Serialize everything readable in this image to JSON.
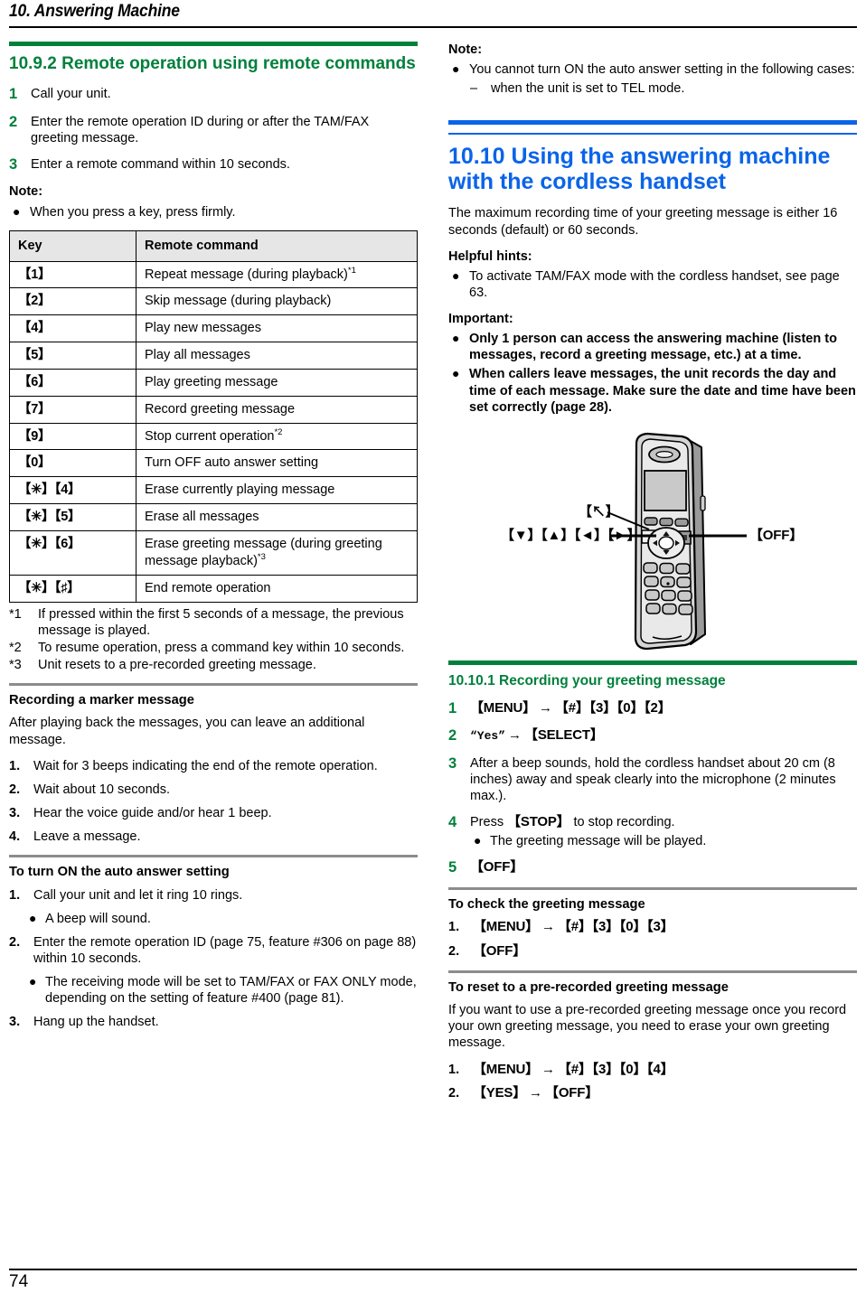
{
  "header": {
    "chapter_title": "10. Answering Machine"
  },
  "footer": {
    "page_number": "74"
  },
  "colors": {
    "green": "#00803C",
    "blue": "#0A64E8",
    "table_header_bg": "#E6E6E6",
    "rule_grey": "#8C8C8C"
  },
  "left": {
    "section": {
      "number_title": "10.9.2 Remote operation using remote commands"
    },
    "steps": [
      {
        "num": "1",
        "text": "Call your unit."
      },
      {
        "num": "2",
        "text": "Enter the remote operation ID during or after the TAM/FAX greeting message."
      },
      {
        "num": "3",
        "text": "Enter a remote command within 10 seconds."
      }
    ],
    "note_label": "Note:",
    "note_items": [
      "When you press a key, press firmly."
    ],
    "table": {
      "headers": [
        "Key",
        "Remote command"
      ],
      "rows": [
        {
          "key": "【1】",
          "command": "Repeat message (during playback)",
          "footnote": "*1"
        },
        {
          "key": "【2】",
          "command": "Skip message (during playback)",
          "footnote": ""
        },
        {
          "key": "【4】",
          "command": "Play new messages",
          "footnote": ""
        },
        {
          "key": "【5】",
          "command": "Play all messages",
          "footnote": ""
        },
        {
          "key": "【6】",
          "command": "Play greeting message",
          "footnote": ""
        },
        {
          "key": "【7】",
          "command": "Record greeting message",
          "footnote": ""
        },
        {
          "key": "【9】",
          "command": "Stop current operation",
          "footnote": "*2"
        },
        {
          "key": "【0】",
          "command": "Turn OFF auto answer setting",
          "footnote": ""
        },
        {
          "key": "【✳】【4】",
          "command": "Erase currently playing message",
          "footnote": ""
        },
        {
          "key": "【✳】【5】",
          "command": "Erase all messages",
          "footnote": ""
        },
        {
          "key": "【✳】【6】",
          "command": "Erase greeting message (during greeting message playback)",
          "footnote": "*3"
        },
        {
          "key": "【✳】【♯】",
          "command": "End remote operation",
          "footnote": ""
        }
      ]
    },
    "footnotes": [
      {
        "mark": "*1",
        "text": "If pressed within the first 5 seconds of a message, the previous message is played."
      },
      {
        "mark": "*2",
        "text": "To resume operation, press a command key within 10 seconds."
      },
      {
        "mark": "*3",
        "text": "Unit resets to a pre-recorded greeting message."
      }
    ],
    "marker_section": {
      "title": "Recording a marker message",
      "intro": "After playing back the messages, you can leave an additional message.",
      "steps": [
        {
          "num": "1.",
          "text": "Wait for 3 beeps indicating the end of the remote operation."
        },
        {
          "num": "2.",
          "text": "Wait about 10 seconds."
        },
        {
          "num": "3.",
          "text": "Hear the voice guide and/or hear 1 beep."
        },
        {
          "num": "4.",
          "text": "Leave a message."
        }
      ]
    },
    "auto_answer_section": {
      "title": "To turn ON the auto answer setting",
      "steps": [
        {
          "num": "1.",
          "text": "Call your unit and let it ring 10 rings.",
          "bullets": [
            "A beep will sound."
          ]
        },
        {
          "num": "2.",
          "text": "Enter the remote operation ID (page 75, feature #306 on page 88) within 10 seconds.",
          "bullets": [
            "The receiving mode will be set to TAM/FAX or FAX ONLY mode, depending on the setting of feature #400 (page 81)."
          ]
        },
        {
          "num": "3.",
          "text": "Hang up the handset.",
          "bullets": []
        }
      ]
    }
  },
  "right": {
    "note_label": "Note:",
    "note_items": [
      "You cannot turn ON the auto answer setting in the following cases:"
    ],
    "note_subitems": [
      {
        "dash": "–",
        "text": "when the unit is set to TEL mode."
      }
    ],
    "section": {
      "number_title": "10.10 Using the answering machine with the cordless handset"
    },
    "intro": "The maximum recording time of your greeting message is either 16 seconds (default) or 60 seconds.",
    "helpful_label": "Helpful hints:",
    "helpful_items": [
      "To activate TAM/FAX mode with the cordless handset, see page 63."
    ],
    "important_label": "Important:",
    "important_items": [
      "Only 1 person can access the answering machine (listen to messages, record a greeting message, etc.) at a time.",
      "When callers leave messages, the unit records the day and time of each message. Make sure the date and time have been set correctly (page 28)."
    ],
    "figure": {
      "alt": "cordless handset",
      "callouts": [
        {
          "name": "talk-key",
          "label": "【↖】"
        },
        {
          "name": "navigator-keys",
          "label": "【▼】【▲】【◄】【►】"
        },
        {
          "name": "off-key",
          "label": "【OFF】"
        }
      ]
    },
    "subsection": {
      "number_title": "10.10.1 Recording your greeting message"
    },
    "record_steps": [
      {
        "num": "1",
        "kind": "kbd",
        "parts": [
          "【MENU】",
          "→",
          "【#】【3】【0】【2】"
        ]
      },
      {
        "num": "2",
        "kind": "quote",
        "quote": "“Yes”",
        "arrow": "→",
        "after": "【SELECT】"
      },
      {
        "num": "3",
        "kind": "text",
        "text": "After a beep sounds, hold the cordless handset about 20 cm (8 inches) away and speak clearly into the microphone (2 minutes max.)."
      },
      {
        "num": "4",
        "kind": "mixed",
        "pre": "Press ",
        "kbd": "【STOP】",
        "post": " to stop recording.",
        "bullets": [
          "The greeting message will be played."
        ]
      },
      {
        "num": "5",
        "kind": "kbd",
        "parts": [
          "【OFF】"
        ]
      }
    ],
    "check_section": {
      "title": "To check the greeting message",
      "steps": [
        {
          "num": "1.",
          "parts": [
            "【MENU】",
            "→",
            "【#】【3】【0】【3】"
          ]
        },
        {
          "num": "2.",
          "parts": [
            "【OFF】"
          ]
        }
      ]
    },
    "reset_section": {
      "title": "To reset to a pre-recorded greeting message",
      "intro": "If you want to use a pre-recorded greeting message once you record your own greeting message, you need to erase your own greeting message.",
      "steps": [
        {
          "num": "1.",
          "parts": [
            "【MENU】",
            "→",
            "【#】【3】【0】【4】"
          ]
        },
        {
          "num": "2.",
          "parts": [
            "【YES】",
            "→",
            "【OFF】"
          ]
        }
      ]
    }
  }
}
